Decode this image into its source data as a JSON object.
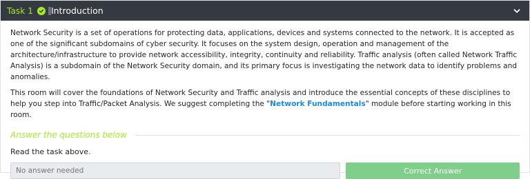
{
  "task": {
    "number_label": "Task 1",
    "title": "Introduction",
    "status_icon": "check-circle-icon",
    "toggle_icon": "chevron-down-icon"
  },
  "content": {
    "paragraph1": "Network Security is a set of operations for protecting data, applications, devices and systems connected to the network. It is accepted as one of the significant subdomains of cyber security. It focuses on the system design, operation and management of the architecture/infrastructure to provide network accessibility, integrity, continuity and reliability. Traffic analysis (often called Network Traffic Analysis) is a subdomain of the Network Security domain, and its primary focus is investigating the network data to identify problems and anomalies.",
    "paragraph2_before": "This room will cover the foundations of Network Security and Traffic analysis and introduce the essential concepts of these disciplines to help you step into Traffic/Packet Analysis. We suggest completing the \"",
    "paragraph2_link": "Network Fundamentals",
    "paragraph2_after": "\" module before starting working in this room."
  },
  "questions": {
    "heading": "Answer the questions below",
    "items": [
      {
        "text": "Read the task above.",
        "answer_placeholder": "No answer needed",
        "button_label": "Correct Answer"
      }
    ]
  },
  "colors": {
    "header_bg": "#343a40",
    "accent_green": "#a3ea2a",
    "link_blue": "#1c8ad8",
    "correct_button": "#7fcf8a"
  }
}
